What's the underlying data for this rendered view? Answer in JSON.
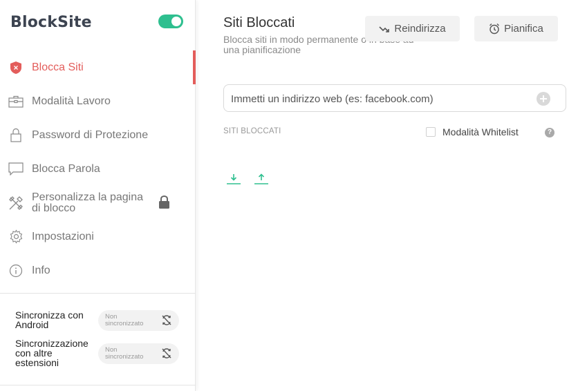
{
  "app": {
    "logo": "BlockSite",
    "enabled": true
  },
  "sidebar": {
    "items": [
      {
        "label": "Blocca Siti",
        "icon": "shield-x-icon",
        "active": true
      },
      {
        "label": "Modalità Lavoro",
        "icon": "briefcase-icon",
        "active": false
      },
      {
        "label": "Password di Protezione",
        "icon": "padlock-icon",
        "active": false
      },
      {
        "label": "Blocca Parola",
        "icon": "speech-bubble-icon",
        "active": false
      },
      {
        "label": "Personalizza la pagina di blocco",
        "icon": "tools-icon",
        "active": false,
        "locked": true
      },
      {
        "label": "Impostazioni",
        "icon": "gear-icon",
        "active": false
      },
      {
        "label": "Info",
        "icon": "info-icon",
        "active": false
      }
    ],
    "sync": [
      {
        "label": "Sincronizza con Android",
        "status": "Non sincronizzato"
      },
      {
        "label": "Sincronizzazione con altre estensioni",
        "status": "Non sincronizzato"
      }
    ]
  },
  "main": {
    "title": "Siti Bloccati",
    "subtitle": "Blocca siti in modo permanente o in base ad una pianificazione",
    "redirect_label": "Reindirizza",
    "schedule_label": "Pianifica",
    "url_placeholder": "Immetti un indirizzo web (es: facebook.com)",
    "url_value": "",
    "section_label": "SITI BLOCCATI",
    "whitelist_label": "Modalità Whitelist",
    "whitelist_checked": false,
    "help_symbol": "?"
  },
  "colors": {
    "accent": "#e35d5b",
    "toggle": "#2ebf8f",
    "io_icons": "#2ebf8f"
  }
}
